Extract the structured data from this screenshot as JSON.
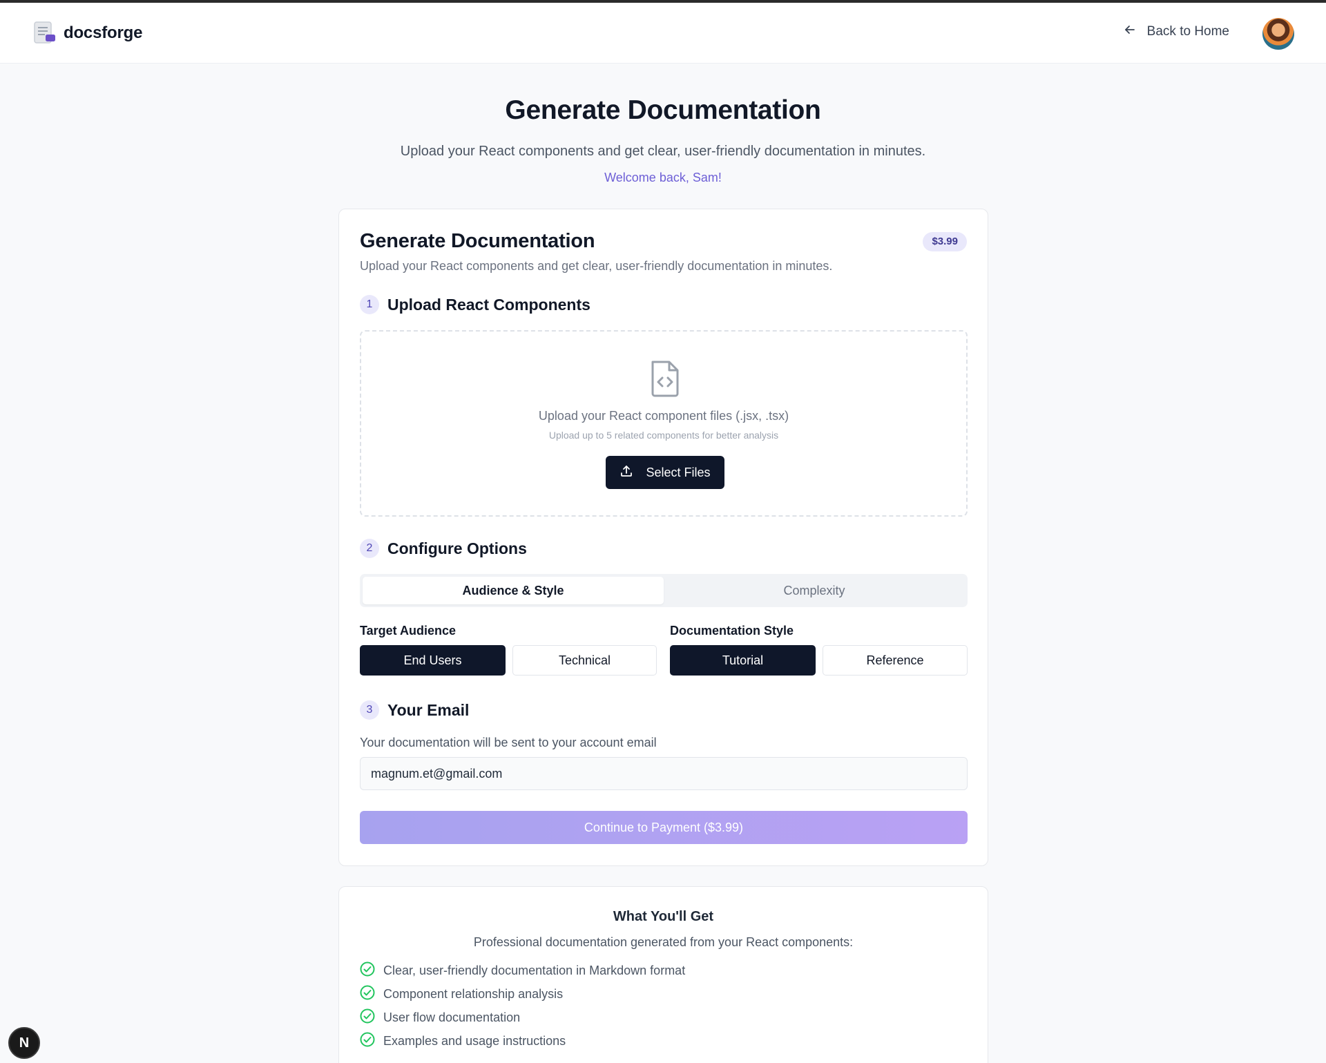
{
  "header": {
    "brand_name": "docsforge",
    "back_label": "Back to Home"
  },
  "hero": {
    "title": "Generate Documentation",
    "subtitle": "Upload your React components and get clear, user-friendly documentation in minutes.",
    "welcome": "Welcome back, Sam!"
  },
  "card": {
    "title": "Generate Documentation",
    "price_badge": "$3.99",
    "subtitle": "Upload your React components and get clear, user-friendly documentation in minutes."
  },
  "steps": [
    {
      "number": "1",
      "title": "Upload React Components"
    },
    {
      "number": "2",
      "title": "Configure Options"
    },
    {
      "number": "3",
      "title": "Your Email"
    }
  ],
  "upload": {
    "text": "Upload your React component files (.jsx, .tsx)",
    "hint": "Upload up to 5 related components for better analysis",
    "button_label": "Select Files"
  },
  "tabs": [
    {
      "label": "Audience & Style",
      "active": true
    },
    {
      "label": "Complexity",
      "active": false
    }
  ],
  "options": {
    "audience": {
      "label": "Target Audience",
      "choices": [
        "End Users",
        "Technical"
      ],
      "selected": "End Users"
    },
    "style": {
      "label": "Documentation Style",
      "choices": [
        "Tutorial",
        "Reference"
      ],
      "selected": "Tutorial"
    }
  },
  "email": {
    "description": "Your documentation will be sent to your account email",
    "value": "magnum.et@gmail.com"
  },
  "payment_button": "Continue to Payment ($3.99)",
  "features": {
    "title": "What You'll Get",
    "subtitle": "Professional documentation generated from your React components:",
    "items": [
      "Clear, user-friendly documentation in Markdown format",
      "Component relationship analysis",
      "User flow documentation",
      "Examples and usage instructions"
    ]
  },
  "dev_badge": "N",
  "colors": {
    "primary_dark": "#0f172a",
    "accent_purple": "#6d5fd6",
    "check_green": "#22c55e"
  }
}
